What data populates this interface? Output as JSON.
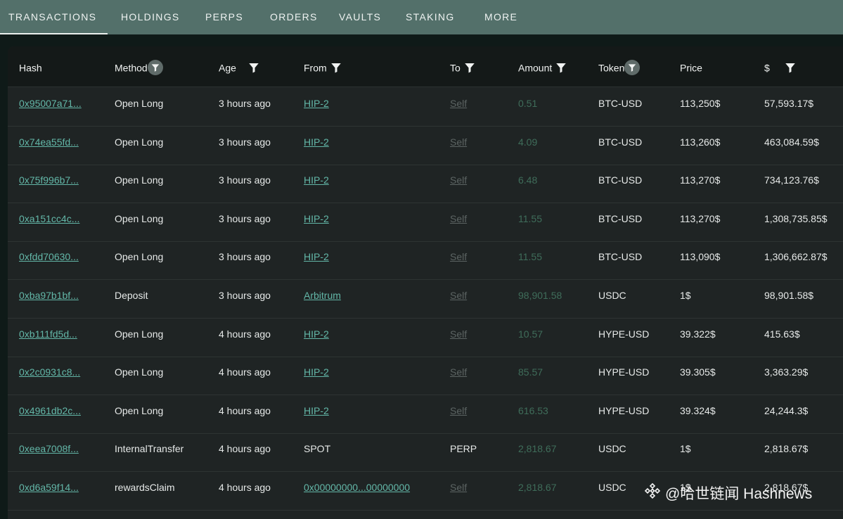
{
  "tabs": [
    {
      "label": "TRANSACTIONS",
      "active": true
    },
    {
      "label": "HOLDINGS",
      "active": false
    },
    {
      "label": "PERPS",
      "active": false
    },
    {
      "label": "ORDERS",
      "active": false
    },
    {
      "label": "VAULTS",
      "active": false
    },
    {
      "label": "STAKING",
      "active": false
    },
    {
      "label": "MORE",
      "active": false
    }
  ],
  "columns": [
    {
      "key": "hash",
      "label": "Hash",
      "filter": "none"
    },
    {
      "key": "method",
      "label": "Method",
      "filter": "round"
    },
    {
      "key": "age",
      "label": "Age",
      "filter": "plain"
    },
    {
      "key": "from",
      "label": "From",
      "filter": "plain"
    },
    {
      "key": "to",
      "label": "To",
      "filter": "plain"
    },
    {
      "key": "amount",
      "label": "Amount",
      "filter": "plain"
    },
    {
      "key": "token",
      "label": "Token",
      "filter": "round"
    },
    {
      "key": "price",
      "label": "Price",
      "filter": "none"
    },
    {
      "key": "usd",
      "label": "$",
      "filter": "plain"
    }
  ],
  "rows": [
    {
      "hash": "0x95007a71...",
      "method": "Open Long",
      "age": "3 hours ago",
      "from": "HIP-2",
      "from_link": true,
      "to": "Self",
      "to_link": true,
      "amount": "0.51",
      "token": "BTC-USD",
      "price": "113,250$",
      "usd": "57,593.17$"
    },
    {
      "hash": "0x74ea55fd...",
      "method": "Open Long",
      "age": "3 hours ago",
      "from": "HIP-2",
      "from_link": true,
      "to": "Self",
      "to_link": true,
      "amount": "4.09",
      "token": "BTC-USD",
      "price": "113,260$",
      "usd": "463,084.59$"
    },
    {
      "hash": "0x75f996b7...",
      "method": "Open Long",
      "age": "3 hours ago",
      "from": "HIP-2",
      "from_link": true,
      "to": "Self",
      "to_link": true,
      "amount": "6.48",
      "token": "BTC-USD",
      "price": "113,270$",
      "usd": "734,123.76$"
    },
    {
      "hash": "0xa151cc4c...",
      "method": "Open Long",
      "age": "3 hours ago",
      "from": "HIP-2",
      "from_link": true,
      "to": "Self",
      "to_link": true,
      "amount": "11.55",
      "token": "BTC-USD",
      "price": "113,270$",
      "usd": "1,308,735.85$"
    },
    {
      "hash": "0xfdd70630...",
      "method": "Open Long",
      "age": "3 hours ago",
      "from": "HIP-2",
      "from_link": true,
      "to": "Self",
      "to_link": true,
      "amount": "11.55",
      "token": "BTC-USD",
      "price": "113,090$",
      "usd": "1,306,662.87$"
    },
    {
      "hash": "0xba97b1bf...",
      "method": "Deposit",
      "age": "3 hours ago",
      "from": "Arbitrum",
      "from_link": true,
      "to": "Self",
      "to_link": true,
      "amount": "98,901.58",
      "token": "USDC",
      "price": "1$",
      "usd": "98,901.58$"
    },
    {
      "hash": "0xb111fd5d...",
      "method": "Open Long",
      "age": "4 hours ago",
      "from": "HIP-2",
      "from_link": true,
      "to": "Self",
      "to_link": true,
      "amount": "10.57",
      "token": "HYPE-USD",
      "price": "39.322$",
      "usd": "415.63$"
    },
    {
      "hash": "0x2c0931c8...",
      "method": "Open Long",
      "age": "4 hours ago",
      "from": "HIP-2",
      "from_link": true,
      "to": "Self",
      "to_link": true,
      "amount": "85.57",
      "token": "HYPE-USD",
      "price": "39.305$",
      "usd": "3,363.29$"
    },
    {
      "hash": "0x4961db2c...",
      "method": "Open Long",
      "age": "4 hours ago",
      "from": "HIP-2",
      "from_link": true,
      "to": "Self",
      "to_link": true,
      "amount": "616.53",
      "token": "HYPE-USD",
      "price": "39.324$",
      "usd": "24,244.3$"
    },
    {
      "hash": "0xeea7008f...",
      "method": "InternalTransfer",
      "age": "4 hours ago",
      "from": "SPOT",
      "from_link": false,
      "to": "PERP",
      "to_link": false,
      "amount": "2,818.67",
      "token": "USDC",
      "price": "1$",
      "usd": "2,818.67$"
    },
    {
      "hash": "0xd6a59f14...",
      "method": "rewardsClaim",
      "age": "4 hours ago",
      "from": "0x00000000...00000000",
      "from_link": true,
      "to": "Self",
      "to_link": true,
      "amount": "2,818.67",
      "token": "USDC",
      "price": "1$",
      "usd": "2,818.67$"
    }
  ],
  "watermark": {
    "text": "@哈世链闻 Hashnews",
    "icon": "binance-logo-icon"
  },
  "colors": {
    "topbar": "#53706a",
    "panel": "#1f2424",
    "header": "#141918",
    "link": "#63b7a8",
    "amount": "#3f6d5a",
    "muted_link": "#5c6463"
  }
}
